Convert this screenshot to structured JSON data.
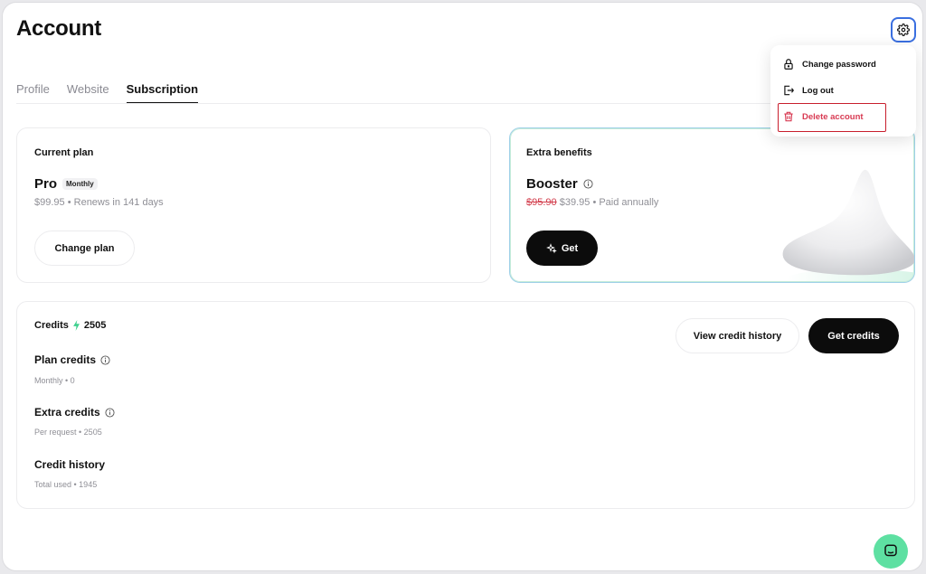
{
  "header": {
    "title": "Account"
  },
  "tabs": [
    {
      "label": "Profile"
    },
    {
      "label": "Website"
    },
    {
      "label": "Subscription"
    }
  ],
  "current_plan": {
    "label": "Current plan",
    "name": "Pro",
    "badge": "Monthly",
    "price": "$99.95",
    "renewal": "• Renews in 141 days",
    "button": "Change plan"
  },
  "extra_benefits": {
    "label": "Extra benefits",
    "name": "Booster",
    "old_price": "$95.90",
    "new_price": "$39.95",
    "billing": "• Paid annually",
    "button": "Get"
  },
  "credits": {
    "label": "Credits",
    "total": "2505",
    "view_history_button": "View credit history",
    "get_credits_button": "Get credits",
    "plan_credits": {
      "title": "Plan credits",
      "sub": "Monthly • 0"
    },
    "extra_credits": {
      "title": "Extra credits",
      "sub": "Per request • 2505"
    },
    "credit_history": {
      "title": "Credit history",
      "sub": "Total used • 1945"
    }
  },
  "settings_menu": {
    "items": [
      {
        "label": "Change password",
        "icon": "lock-icon"
      },
      {
        "label": "Log out",
        "icon": "logout-icon"
      },
      {
        "label": "Delete account",
        "icon": "trash-icon"
      }
    ]
  },
  "colors": {
    "accent_focus": "#3a6fe0",
    "danger": "#d83a52",
    "credit_bolt": "#3fd08e",
    "chat": "#5ee0a2"
  }
}
